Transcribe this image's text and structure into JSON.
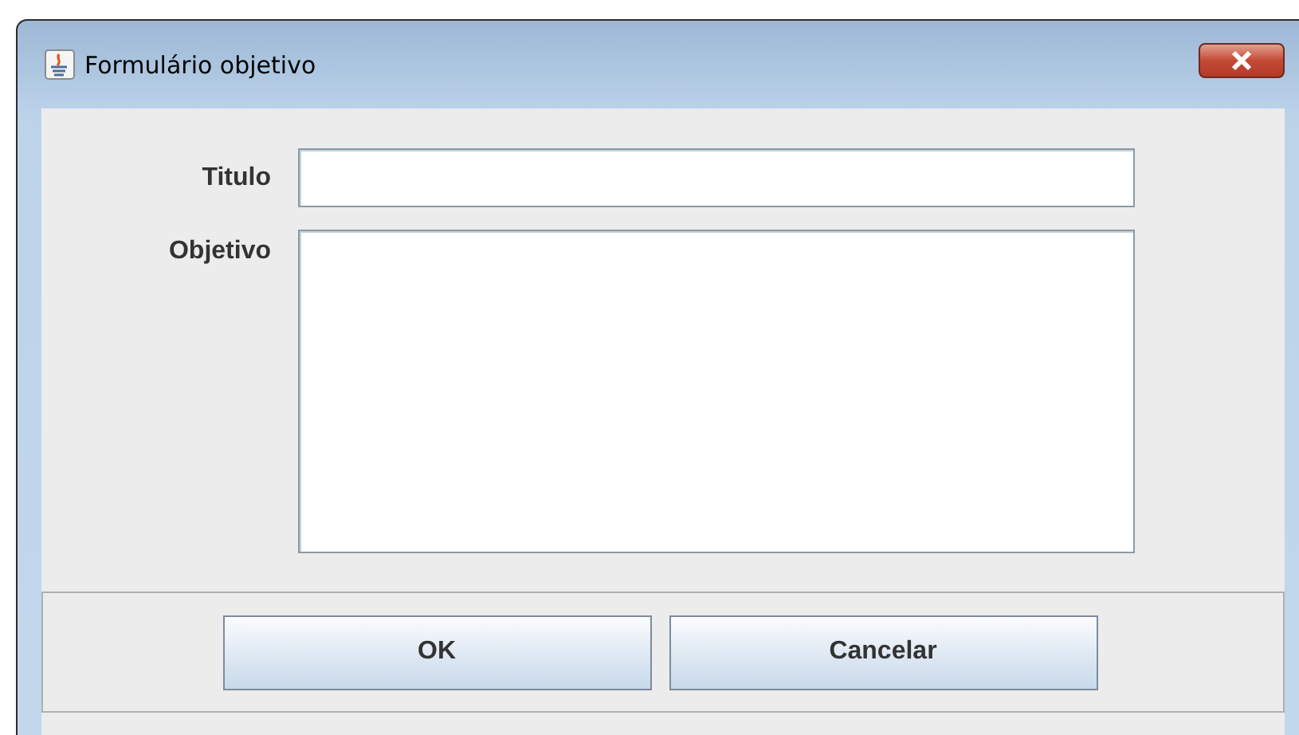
{
  "window": {
    "title": "Formulário objetivo"
  },
  "fields": [
    {
      "label": "Titulo",
      "kind": "line"
    },
    {
      "label": "Objetivo",
      "kind": "area"
    }
  ],
  "buttons": [
    "OK",
    "Cancelar"
  ]
}
